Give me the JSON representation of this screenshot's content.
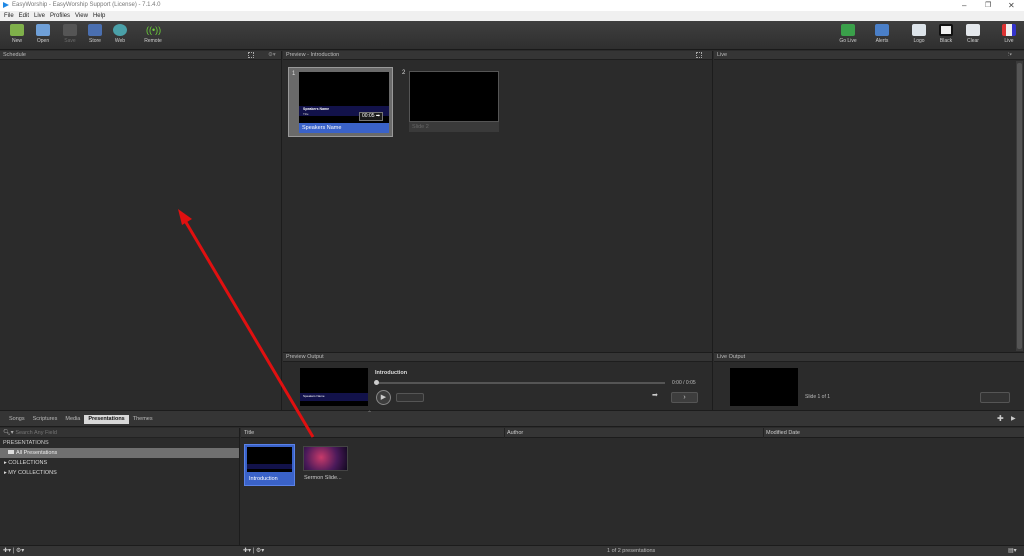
{
  "window": {
    "title": "EasyWorship - EasyWorship Support (License) - 7.1.4.0"
  },
  "menu": [
    "File",
    "Edit",
    "Live",
    "Profiles",
    "View",
    "Help"
  ],
  "toolbar": {
    "left": [
      {
        "label": "New",
        "icon": "new-icon"
      },
      {
        "label": "Open",
        "icon": "open-icon"
      },
      {
        "label": "Save",
        "icon": "save-icon"
      },
      {
        "label": "Store",
        "icon": "store-icon"
      },
      {
        "label": "Web",
        "icon": "web-icon"
      },
      {
        "label": "Remote",
        "icon": "remote-icon"
      }
    ],
    "right": [
      {
        "label": "Go Live",
        "icon": "go-live-icon"
      },
      {
        "label": "Alerts",
        "icon": "alerts-icon"
      },
      {
        "label": "Logo",
        "icon": "logo-icon"
      },
      {
        "label": "Black",
        "icon": "black-icon"
      },
      {
        "label": "Clear",
        "icon": "clear-icon"
      },
      {
        "label": "Live",
        "icon": "live-icon"
      }
    ]
  },
  "schedule": {
    "title": "Schedule"
  },
  "preview": {
    "title": "Preview - Introduction",
    "slides": [
      {
        "number": "1",
        "label": "Speakers Name",
        "inner_title": "Speakers Name",
        "inner_sub": "Title",
        "time": "00:05"
      },
      {
        "number": "2",
        "label": "Slide 2"
      }
    ]
  },
  "live": {
    "title": "Live"
  },
  "preview_output": {
    "title": "Preview Output",
    "name": "Introduction",
    "time": "0:00 / 0:05"
  },
  "live_output": {
    "title": "Live Output",
    "slide_info": "Slide 1 of 1"
  },
  "library": {
    "tabs": [
      "Songs",
      "Scriptures",
      "Media",
      "Presentations",
      "Themes"
    ],
    "active_tab": "Presentations",
    "search_placeholder": "Search Any Field",
    "tree": {
      "header": "PRESENTATIONS",
      "all": "All Presentations",
      "collections": "COLLECTIONS",
      "my_collections": "MY COLLECTIONS"
    },
    "columns": [
      "Title",
      "Author",
      "Modified Date"
    ],
    "items": [
      {
        "title": "Introduction"
      },
      {
        "title": "Sermon Slide..."
      }
    ],
    "status": "1 of 2 presentations"
  },
  "colors": {
    "accent": "#3a62c8",
    "arrow": "#e01010",
    "panel": "#2b2b2b"
  }
}
